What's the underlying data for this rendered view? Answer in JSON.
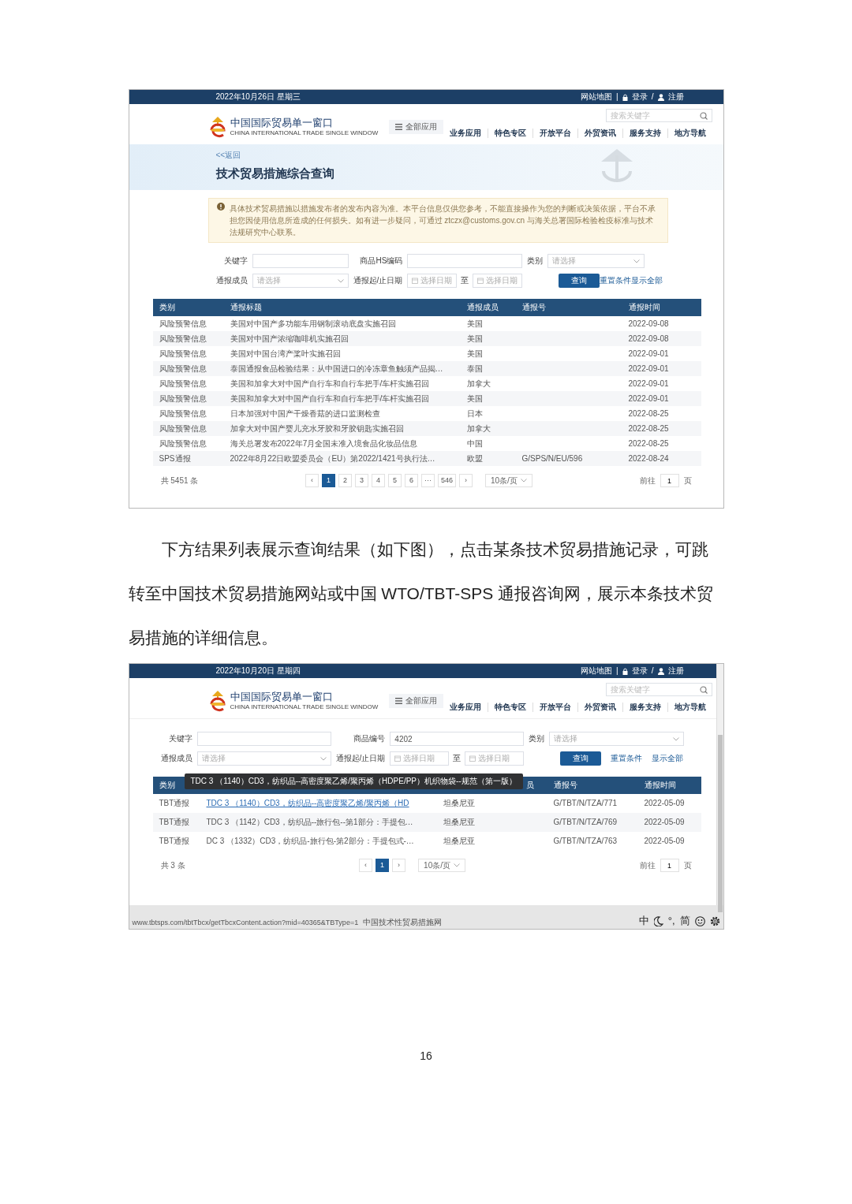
{
  "screenshots": [
    {
      "top_bar": {
        "date": "2022年10月26日 星期三",
        "site_map": "网站地图",
        "divider": "|",
        "login": "登录",
        "slash": "/",
        "register": "注册"
      },
      "header": {
        "search_placeholder": "搜索关键字",
        "logo_title": "中国国际贸易单一窗口",
        "logo_subtitle": "CHINA INTERNATIONAL TRADE SINGLE WINDOW",
        "all_apps": "全部应用",
        "nav": [
          "业务应用",
          "特色专区",
          "开放平台",
          "外贸资讯",
          "服务支持",
          "地方导航"
        ]
      },
      "banner": {
        "back": "<<返回",
        "title": "技术贸易措施综合查询"
      },
      "notice": {
        "text": "具体技术贸易措施以措施发布者的发布内容为准。本平台信息仅供您参考，不能直接操作为您的判断或决策依据，平台不承担您因使用信息所造成的任何损失。如有进一步疑问，可通过 ztczx@customs.gov.cn 与海关总署国际检验检疫标准与技术法规研究中心联系。"
      },
      "form": {
        "fields": [
          {
            "label": "关键字",
            "kind": "text"
          },
          {
            "label": "商品HS编码",
            "kind": "text"
          },
          {
            "label": "类别",
            "kind": "select",
            "placeholder": "请选择"
          },
          {
            "label": "通报成员",
            "kind": "select",
            "placeholder": "请选择"
          },
          {
            "label": "通报起/止日期",
            "kind": "daterange",
            "placeholder": "选择日期",
            "separator": "至",
            "placeholder_end": "选择日期"
          }
        ],
        "buttons": [
          {
            "label": "查询",
            "kind": "primary"
          },
          {
            "label": "重置条件",
            "kind": "link"
          },
          {
            "label": "显示全部",
            "kind": "link"
          }
        ]
      },
      "table": {
        "columns": [
          {
            "label": "类别"
          },
          {
            "label": "通报标题"
          },
          {
            "label": "通报成员"
          },
          {
            "label": "通报号"
          },
          {
            "label": "通报时间"
          }
        ],
        "rows": [
          {
            "category": "风险预警信息",
            "title": "美国对中国产多功能车用钢制滚动底盘实施召回",
            "member": "美国",
            "date": "2022-09-08"
          },
          {
            "category": "风险预警信息",
            "title": "美国对中国产浓缩咖啡机实施召回",
            "member": "美国",
            "date": "2022-09-08"
          },
          {
            "category": "风险预警信息",
            "title": "美国对中国台湾产桨叶实施召回",
            "member": "美国",
            "date": "2022-09-01"
          },
          {
            "category": "风险预警信息",
            "title": "泰国通报食品检验结果：从中国进口的冷冻章鱼触须产品揭…",
            "member": "泰国",
            "date": "2022-09-01"
          },
          {
            "category": "风险预警信息",
            "title": "美国和加拿大对中国产自行车和自行车把手/车杆实施召回",
            "member": "加拿大",
            "date": "2022-09-01"
          },
          {
            "category": "风险预警信息",
            "title": "美国和加拿大对中国产自行车和自行车把手/车杆实施召回",
            "member": "美国",
            "date": "2022-09-01"
          },
          {
            "category": "风险预警信息",
            "title": "日本加强对中国产干燥香菇的进口监测检查",
            "member": "日本",
            "date": "2022-08-25"
          },
          {
            "category": "风险预警信息",
            "title": "加拿大对中国产婴儿充水牙胶和牙胶钥匙实施召回",
            "member": "加拿大",
            "date": "2022-08-25"
          },
          {
            "category": "风险预警信息",
            "title": "海关总署发布2022年7月全国未准入境食品化妆品信息",
            "member": "中国",
            "date": "2022-08-25"
          },
          {
            "category": "SPS通报",
            "title": "2022年8月22日欧盟委员会（EU）第2022/1421号执行法…",
            "member": "欧盟",
            "number": "G/SPS/N/EU/596",
            "date": "2022-08-24"
          }
        ]
      },
      "pagination": {
        "total": "共 5451 条",
        "prev": "‹",
        "next": "›",
        "pages": [
          {
            "label": "1",
            "selected": true
          },
          {
            "label": "2",
            "selected": false
          },
          {
            "label": "3",
            "selected": false
          },
          {
            "label": "4",
            "selected": false
          },
          {
            "label": "5",
            "selected": false
          },
          {
            "label": "6",
            "selected": false
          },
          {
            "label": "···",
            "selected": false
          },
          {
            "label": "546",
            "selected": false
          }
        ],
        "page_size": "10条/页",
        "goto_label": "前往",
        "goto_value": "1",
        "goto_suffix": "页"
      }
    },
    {
      "top_bar": {
        "date": "2022年10月20日 星期四",
        "site_map": "网站地图",
        "divider": "|",
        "login": "登录",
        "slash": "/",
        "register": "注册"
      },
      "header": {
        "search_placeholder": "搜索关键字",
        "logo_title": "中国国际贸易单一窗口",
        "logo_subtitle": "CHINA INTERNATIONAL TRADE SINGLE WINDOW",
        "all_apps": "全部应用",
        "nav": [
          "业务应用",
          "特色专区",
          "开放平台",
          "外贸资讯",
          "服务支持",
          "地方导航"
        ]
      },
      "form": {
        "fields": [
          {
            "label": "关键字",
            "kind": "text"
          },
          {
            "label": "商品编号",
            "kind": "text",
            "value": "4202"
          },
          {
            "label": "类别",
            "kind": "select",
            "placeholder": "请选择"
          },
          {
            "label": "通报成员",
            "kind": "select",
            "placeholder": "请选择"
          },
          {
            "label": "通报起/止日期",
            "kind": "daterange",
            "placeholder": "选择日期",
            "separator": "至",
            "placeholder_end": "选择日期"
          }
        ],
        "buttons": [
          {
            "label": "查询",
            "kind": "primary"
          },
          {
            "label": "重置条件",
            "kind": "link"
          },
          {
            "label": "显示全部",
            "kind": "link"
          }
        ]
      },
      "table": {
        "columns": [
          {
            "label": "类别"
          },
          {},
          {
            "label": "员"
          },
          {
            "label": "通报号"
          },
          {
            "label": "通报时间"
          }
        ],
        "tooltip": "TDC 3 （1140）CD3，纺织品--高密度聚乙烯/聚丙烯（HDPE/PP）机织物袋--规范（第一版）",
        "rows": [
          {
            "category": "TBT通报",
            "title": "TDC 3 （1140）CD3，纺织品--高密度聚乙烯/聚丙烯（HD",
            "member": "坦桑尼亚",
            "number": "G/TBT/N/TZA/771",
            "date": "2022-05-09",
            "hovered": true
          },
          {
            "category": "TBT通报",
            "title": "TDC 3 （1142）CD3，纺织品--旅行包--第1部分：手提包…",
            "member": "坦桑尼亚",
            "number": "G/TBT/N/TZA/769",
            "date": "2022-05-09",
            "hovered": false
          },
          {
            "category": "TBT通报",
            "title": "DC 3 （1332）CD3，纺织品-旅行包-第2部分：手提包式-…",
            "member": "坦桑尼亚",
            "number": "G/TBT/N/TZA/763",
            "date": "2022-05-09",
            "hovered": false
          }
        ]
      },
      "pagination": {
        "total": "共 3 条",
        "prev": "‹",
        "next": "›",
        "pages": [
          {
            "label": "1",
            "selected": true
          }
        ],
        "page_size": "10条/页",
        "goto_label": "前往",
        "goto_value": "1",
        "goto_suffix": "页"
      },
      "status_bar": {
        "url": "www.tbtsps.com/tbtTbcx/getTbcxContent.action?mid=40365&TBType=1",
        "title": "中国技术性贸易措施网",
        "ime_mode": "中",
        "punct": "°,",
        "script": "简"
      }
    }
  ],
  "paragraph": "下方结果列表展示查询结果（如下图），点击某条技术贸易措施记录，可跳转至中国技术贸易措施网站或中国 WTO/TBT-SPS 通报咨询网，展示本条技术贸易措施的详细信息。",
  "page_number": "16"
}
